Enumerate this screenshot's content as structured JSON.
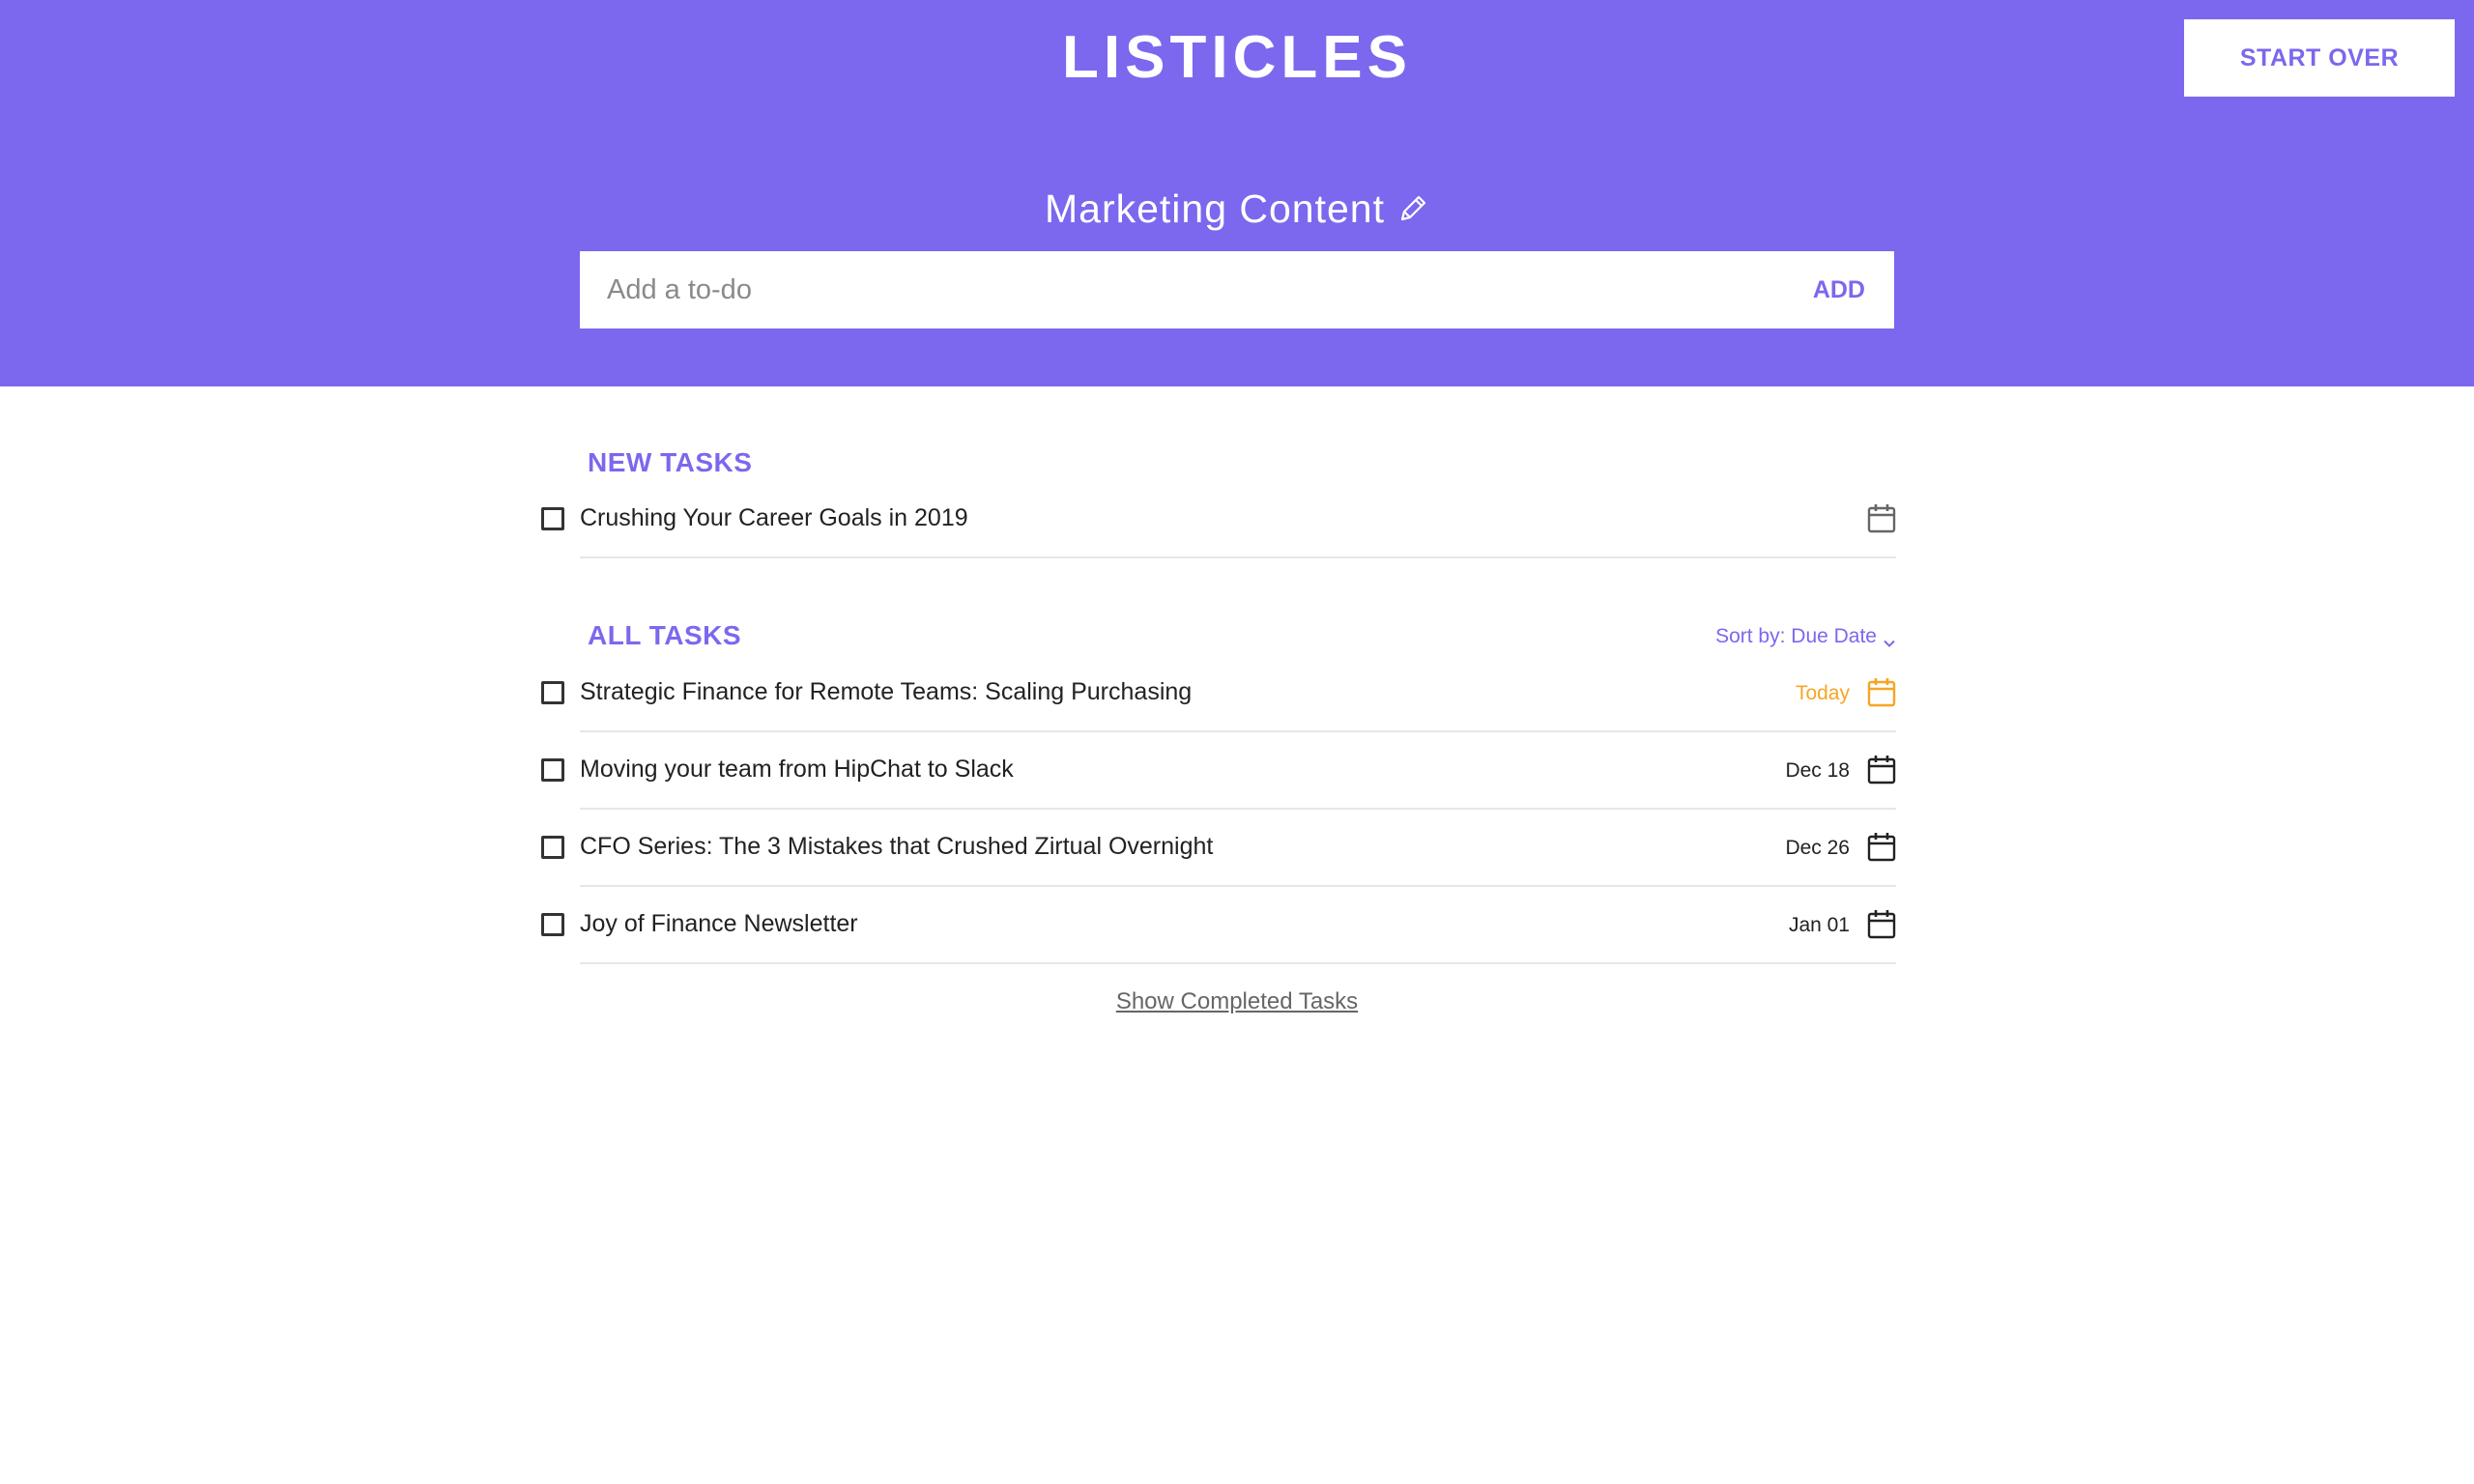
{
  "app": {
    "title": "LISTICLES"
  },
  "header": {
    "start_over_label": "START OVER",
    "list_title": "Marketing Content",
    "add_placeholder": "Add a to-do",
    "add_label": "ADD"
  },
  "colors": {
    "accent": "#7b68ee",
    "today": "#f5a623",
    "text": "#222222",
    "divider": "#e6e6e6"
  },
  "new_tasks": {
    "heading": "NEW TASKS",
    "items": [
      {
        "text": "Crushing Your Career Goals in 2019",
        "date": "",
        "icon": "calendar-icon"
      }
    ]
  },
  "all_tasks": {
    "heading": "ALL TASKS",
    "sort_label": "Sort by: Due Date",
    "items": [
      {
        "text": "Strategic Finance for Remote Teams: Scaling Purchasing",
        "date": "Today",
        "status": "today",
        "icon": "calendar-icon"
      },
      {
        "text": "Moving your team from HipChat to Slack",
        "date": "Dec 18",
        "status": "scheduled",
        "icon": "calendar-icon"
      },
      {
        "text": "CFO Series: The 3 Mistakes that Crushed Zirtual Overnight",
        "date": "Dec 26",
        "status": "scheduled",
        "icon": "calendar-icon"
      },
      {
        "text": "Joy of Finance Newsletter",
        "date": "Jan 01",
        "status": "scheduled",
        "icon": "calendar-icon"
      }
    ]
  },
  "footer": {
    "show_completed_label": "Show Completed Tasks"
  }
}
